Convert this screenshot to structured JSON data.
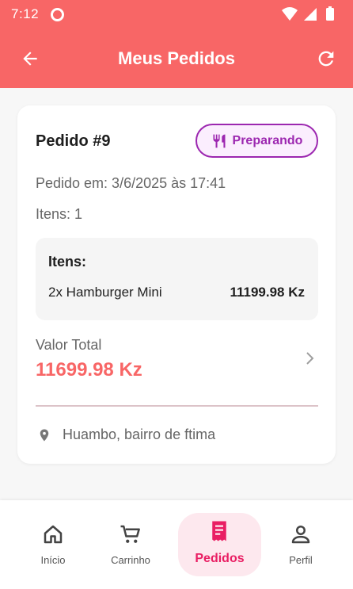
{
  "status_bar": {
    "time": "7:12"
  },
  "appbar": {
    "title": "Meus Pedidos"
  },
  "order": {
    "title": "Pedido #9",
    "status": "Preparando",
    "date": "Pedido em: 3/6/2025 às 17:41",
    "count": "Itens: 1",
    "items_heading": "Itens:",
    "items": [
      {
        "name": "2x Hamburger Mini",
        "price": "11199.98 Kz"
      }
    ],
    "total_label": "Valor Total",
    "total_value": "11699.98 Kz",
    "address": "Huambo, bairro de ftima"
  },
  "bottom_nav": {
    "items": [
      {
        "label": "Início",
        "icon": "home-icon"
      },
      {
        "label": "Carrinho",
        "icon": "cart-icon"
      },
      {
        "label": "Pedidos",
        "icon": "receipt-icon",
        "active": true
      },
      {
        "label": "Perfil",
        "icon": "person-icon"
      }
    ]
  },
  "colors": {
    "primary": "#f86666",
    "status_accent": "#9c27b0",
    "nav_active": "#e91e63"
  }
}
